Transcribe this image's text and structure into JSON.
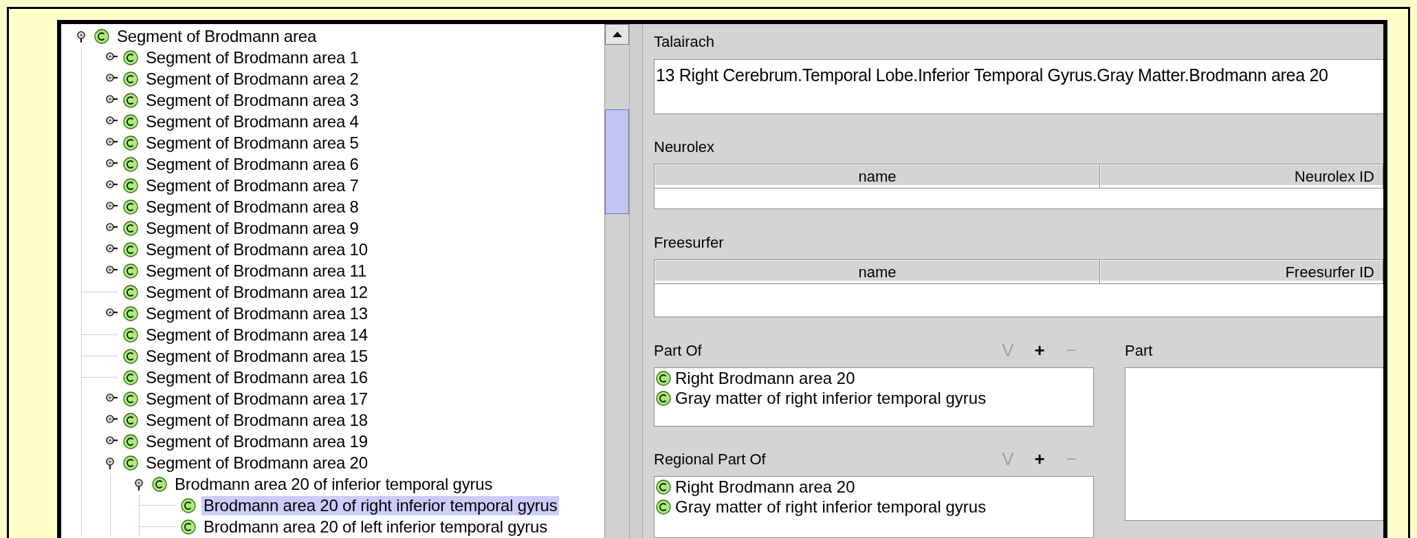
{
  "tree": {
    "label": "Segment of Brodmann area",
    "expanded": true,
    "selected": false,
    "children": [
      {
        "label": "Segment of Brodmann area 1",
        "expanded": false,
        "selected": false
      },
      {
        "label": "Segment of Brodmann area 2",
        "expanded": false,
        "selected": false
      },
      {
        "label": "Segment of Brodmann area 3",
        "expanded": false,
        "selected": false
      },
      {
        "label": "Segment of Brodmann area 4",
        "expanded": false,
        "selected": false
      },
      {
        "label": "Segment of Brodmann area 5",
        "expanded": false,
        "selected": false
      },
      {
        "label": "Segment of Brodmann area 6",
        "expanded": false,
        "selected": false
      },
      {
        "label": "Segment of Brodmann area 7",
        "expanded": false,
        "selected": false
      },
      {
        "label": "Segment of Brodmann area 8",
        "expanded": false,
        "selected": false
      },
      {
        "label": "Segment of Brodmann area 9",
        "expanded": false,
        "selected": false
      },
      {
        "label": "Segment of Brodmann area 10",
        "expanded": false,
        "selected": false
      },
      {
        "label": "Segment of Brodmann area 11",
        "expanded": false,
        "selected": false
      },
      {
        "label": "Segment of Brodmann area 12",
        "selected": false
      },
      {
        "label": "Segment of Brodmann area 13",
        "expanded": false,
        "selected": false
      },
      {
        "label": "Segment of Brodmann area 14",
        "selected": false
      },
      {
        "label": "Segment of Brodmann area 15",
        "selected": false
      },
      {
        "label": "Segment of Brodmann area 16",
        "selected": false
      },
      {
        "label": "Segment of Brodmann area 17",
        "expanded": false,
        "selected": false
      },
      {
        "label": "Segment of Brodmann area 18",
        "expanded": false,
        "selected": false
      },
      {
        "label": "Segment of Brodmann area 19",
        "expanded": false,
        "selected": false
      },
      {
        "label": "Segment of Brodmann area 20",
        "expanded": true,
        "selected": false,
        "children": [
          {
            "label": "Brodmann area 20 of inferior temporal gyrus",
            "expanded": true,
            "selected": false,
            "children": [
              {
                "label": "Brodmann area 20 of right inferior temporal gyrus",
                "selected": true
              },
              {
                "label": "Brodmann area 20 of left inferior temporal gyrus",
                "selected": false
              }
            ]
          }
        ]
      }
    ]
  },
  "talairach": {
    "label": "Talairach",
    "value": "13 Right Cerebrum.Temporal Lobe.Inferior Temporal Gyrus.Gray Matter.Brodmann area 20"
  },
  "neurolex": {
    "label": "Neurolex",
    "columns": [
      "name",
      "Neurolex ID"
    ]
  },
  "freesurfer": {
    "label": "Freesurfer",
    "columns": [
      "name",
      "Freesurfer ID"
    ]
  },
  "part_of": {
    "label": "Part Of",
    "buttons": [
      {
        "label": "V",
        "disabled": true
      },
      {
        "label": "+",
        "disabled": false
      },
      {
        "label": "−",
        "disabled": true
      }
    ],
    "items": [
      "Right Brodmann area 20",
      "Gray matter of right inferior temporal gyrus"
    ]
  },
  "regional_part_of": {
    "label": "Regional Part Of",
    "buttons": [
      {
        "label": "V",
        "disabled": true
      },
      {
        "label": "+",
        "disabled": false
      },
      {
        "label": "−",
        "disabled": true
      }
    ],
    "items": [
      "Right Brodmann area 20",
      "Gray matter of right inferior temporal gyrus"
    ]
  },
  "part": {
    "label": "Part"
  }
}
